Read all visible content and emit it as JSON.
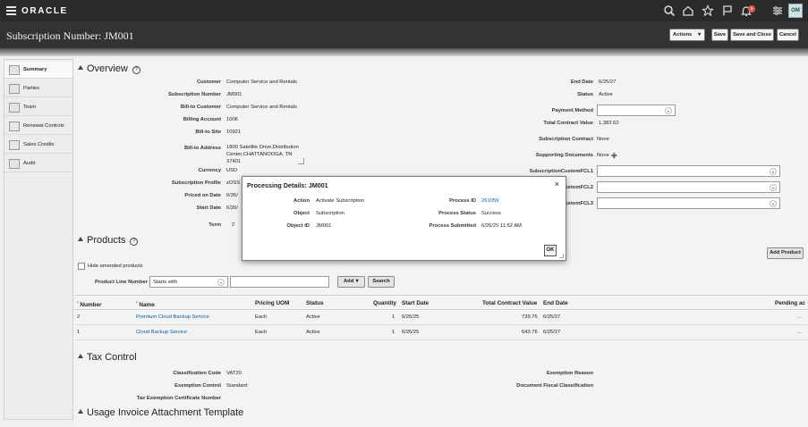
{
  "header": {
    "logo": "ORACLE",
    "notification_count": "6",
    "avatar_initials": "OM"
  },
  "titlebar": {
    "title": "Subscription Number: JM001",
    "actions_label": "Actions",
    "save_label": "Save",
    "save_close_label": "Save and Close",
    "cancel_label": "Cancel"
  },
  "sidebar": {
    "items": [
      {
        "label": "Summary",
        "active": true
      },
      {
        "label": "Parties"
      },
      {
        "label": "Team"
      },
      {
        "label": "Renewal Controls"
      },
      {
        "label": "Sales Credits"
      },
      {
        "label": "Audit"
      }
    ]
  },
  "overview": {
    "heading": "Overview",
    "customer_label": "Customer",
    "customer": "Computer Service and Rentals",
    "subscription_number_label": "Subscription Number",
    "subscription_number": "JM001",
    "bill_to_customer_label": "Bill-to Customer",
    "bill_to_customer": "Computer Service and Rentals",
    "billing_account_label": "Billing Account",
    "billing_account": "1006",
    "bill_to_site_label": "Bill-to Site",
    "bill_to_site": "10921",
    "bill_to_address_label": "Bill-to Address",
    "bill_to_address_line1": "1800 Satellite Drive,Distribution",
    "bill_to_address_line2": "Center,CHATTANOOGA, TN",
    "bill_to_address_line3": "37401",
    "currency_label": "Currency",
    "currency": "USD",
    "subscription_profile_label": "Subscription Profile",
    "subscription_profile": "zOSS",
    "priced_on_date_label": "Priced on Date",
    "priced_on_date": "6/26/",
    "start_date_label": "Start Date",
    "start_date": "6/26/",
    "term_label": "Term",
    "term": "2",
    "end_date_label": "End Date",
    "end_date": "6/25/27",
    "status_label": "Status",
    "status": "Active",
    "payment_method_label": "Payment Method",
    "total_contract_value_label": "Total Contract Value",
    "total_contract_value": "1,383.52",
    "subscription_contract_label": "Subscription Contract",
    "subscription_contract": "None",
    "supporting_documents_label": "Supporting Documents",
    "supporting_documents": "None",
    "custom_fcl1_label": "SubscriptionCustomFCL1",
    "custom_fcl2_label": "ustomFCL2",
    "custom_fcl3_label": "ustomFCL3"
  },
  "products": {
    "heading": "Products",
    "add_product_label": "Add Product",
    "hide_amended_label": "Hide amended products",
    "product_line_number_label": "Product Line Number",
    "operator_value": "Starts with",
    "add_label": "Add",
    "search_label": "Search",
    "columns": [
      "Number",
      "Name",
      "Pricing UOM",
      "Status",
      "Quantity",
      "Start Date",
      "Total Contract Value",
      "End Date",
      "Pending ac"
    ],
    "rows": [
      {
        "number": "2",
        "name": "Premium Cloud Backup Service",
        "uom": "Each",
        "status": "Active",
        "quantity": "1",
        "start": "6/26/25",
        "value": "739.76",
        "end": "6/25/27",
        "pending": "..."
      },
      {
        "number": "1",
        "name": "Cloud Backup Service",
        "uom": "Each",
        "status": "Active",
        "quantity": "1",
        "start": "6/26/25",
        "value": "643.76",
        "end": "6/25/27",
        "pending": "..."
      }
    ]
  },
  "tax": {
    "heading": "Tax Control",
    "classification_code_label": "Classification Code",
    "classification_code": "VAT20",
    "exemption_control_label": "Exemption Control",
    "exemption_control": "Standard",
    "exemption_cert_label": "Tax Exemption Certificate Number",
    "exemption_reason_label": "Exemption Reason",
    "doc_fiscal_label": "Document Fiscal Classification"
  },
  "usage": {
    "heading": "Usage Invoice Attachment Template"
  },
  "dialog": {
    "title": "Processing Details: JM001",
    "close": "×",
    "action_label": "Action",
    "action": "Activate Subscription",
    "object_label": "Object",
    "object": "Subscription",
    "object_id_label": "Object ID",
    "object_id": "JM001",
    "process_id_label": "Process ID",
    "process_id": "261059",
    "process_status_label": "Process Status",
    "process_status": "Success",
    "process_submitted_label": "Process Submitted",
    "process_submitted": "6/26/25 11:52 AM",
    "ok_label": "OK"
  }
}
